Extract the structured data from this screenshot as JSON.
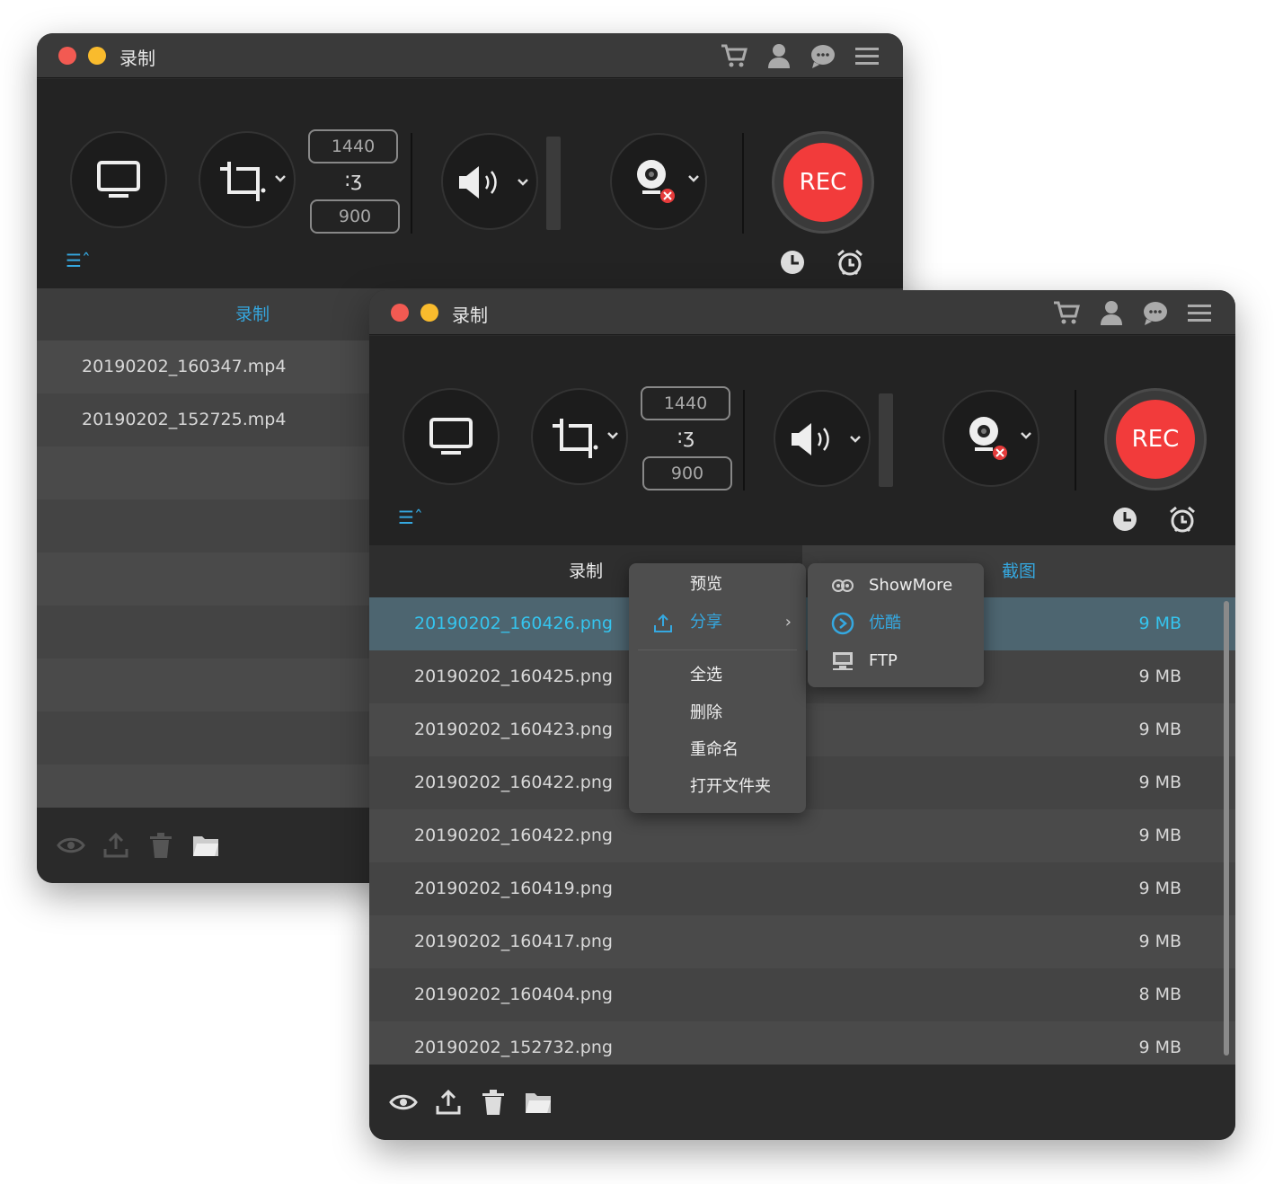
{
  "back_window": {
    "title": "录制",
    "dim_width": "1440",
    "dim_height": "900",
    "rec_label": "REC",
    "tab_record": "录制",
    "files": [
      {
        "name": "20190202_160347.mp4"
      },
      {
        "name": "20190202_152725.mp4"
      }
    ]
  },
  "front_window": {
    "title": "录制",
    "dim_width": "1440",
    "dim_height": "900",
    "rec_label": "REC",
    "tab_record": "录制",
    "tab_screenshot": "截图",
    "files": [
      {
        "name": "20190202_160426.png",
        "size": "9 MB"
      },
      {
        "name": "20190202_160425.png",
        "size": "9 MB"
      },
      {
        "name": "20190202_160423.png",
        "size": "9 MB"
      },
      {
        "name": "20190202_160422.png",
        "size": "9 MB"
      },
      {
        "name": "20190202_160422.png",
        "size": "9 MB"
      },
      {
        "name": "20190202_160419.png",
        "size": "9 MB"
      },
      {
        "name": "20190202_160417.png",
        "size": "9 MB"
      },
      {
        "name": "20190202_160404.png",
        "size": "8 MB"
      },
      {
        "name": "20190202_152732.png",
        "size": "9 MB"
      }
    ]
  },
  "context_menu": {
    "preview": "预览",
    "share": "分享",
    "select_all": "全选",
    "delete": "删除",
    "rename": "重命名",
    "open_folder": "打开文件夹"
  },
  "share_submenu": {
    "showmore": "ShowMore",
    "youku": "优酷",
    "ftp": "FTP"
  },
  "colors": {
    "accent": "#35a8e0",
    "rec": "#f23b3b",
    "close": "#f25a52",
    "minimize": "#f9bb2d"
  },
  "icons": [
    "cart-icon",
    "user-icon",
    "chat-icon",
    "menu-icon",
    "monitor-icon",
    "crop-icon",
    "link-icon",
    "speaker-icon",
    "webcam-icon",
    "clock-icon",
    "alarm-icon",
    "list-icon",
    "eye-icon",
    "upload-icon",
    "trash-icon",
    "folder-icon"
  ]
}
